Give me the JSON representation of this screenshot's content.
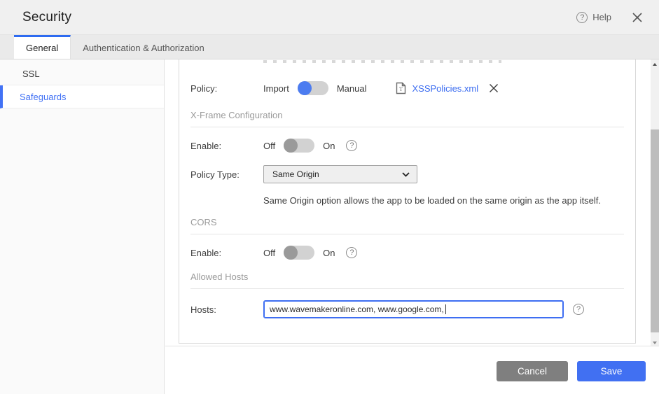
{
  "header": {
    "title": "Security",
    "help_label": "Help"
  },
  "tabs": [
    {
      "label": "General",
      "active": true
    },
    {
      "label": "Authentication & Authorization",
      "active": false
    }
  ],
  "sidebar": {
    "items": [
      {
        "label": "SSL",
        "active": false
      },
      {
        "label": "Safeguards",
        "active": true
      }
    ]
  },
  "form": {
    "policy": {
      "label": "Policy:",
      "import_label": "Import",
      "manual_label": "Manual",
      "selected": "Import",
      "file_name": "XSSPolicies.xml"
    },
    "xframe": {
      "title": "X-Frame Configuration",
      "enable_label": "Enable:",
      "off_label": "Off",
      "on_label": "On",
      "enable_state": "off",
      "policy_type_label": "Policy Type:",
      "policy_type_value": "Same Origin",
      "help_text": "Same Origin option allows the app to be loaded on the same origin as the app itself."
    },
    "cors": {
      "title": "CORS",
      "enable_label": "Enable:",
      "off_label": "Off",
      "on_label": "On",
      "enable_state": "off"
    },
    "allowed_hosts": {
      "title": "Allowed Hosts",
      "hosts_label": "Hosts:",
      "hosts_value": "www.wavemakeronline.com, www.google.com, "
    }
  },
  "footer": {
    "cancel_label": "Cancel",
    "save_label": "Save"
  },
  "colors": {
    "accent_blue": "#4272f5",
    "link_blue": "#3b6cf0",
    "save_button": "#4170f2",
    "cancel_button": "#7f7f7f",
    "toggle_on_knob": "#4c7cf0",
    "toggle_off_knob": "#9a9a9a",
    "toggle_track": "#d2d2d2"
  }
}
